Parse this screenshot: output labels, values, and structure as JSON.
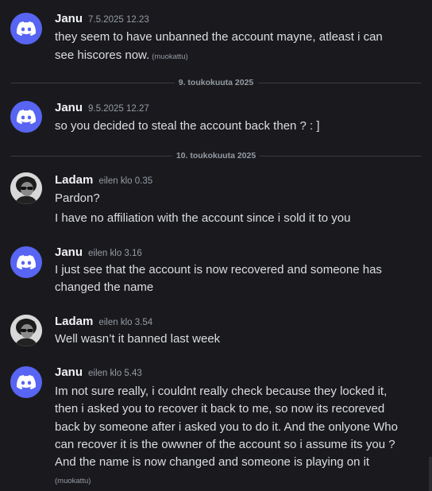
{
  "colors": {
    "background": "#1a1a1e",
    "discord_blurple": "#5865f2",
    "username": "#f2f3f5",
    "message_text": "#dbdee1",
    "muted": "#949ba4"
  },
  "messages": [
    {
      "author": "Janu",
      "avatar_icon": "discord-logo-icon",
      "timestamp": "7.5.2025 12.23",
      "lines": [
        "they seem to have unbanned the account mayne,  atleast i can",
        "see hiscores now."
      ],
      "edited": "(muokattu)"
    },
    {
      "author": "Janu",
      "avatar_icon": "discord-logo-icon",
      "timestamp": "9.5.2025 12.27",
      "lines": [
        "so you decided to steal the account back then ? : ]"
      ]
    },
    {
      "author": "Ladam",
      "avatar_icon": "profile-photo",
      "timestamp": "eilen klo 0.35",
      "lines": [
        "Pardon?",
        "I have no affiliation with the account since i sold it to you"
      ]
    },
    {
      "author": "Janu",
      "avatar_icon": "discord-logo-icon",
      "timestamp": "eilen klo 3.16",
      "lines": [
        "I just see that the account is now recovered and someone has",
        "changed the name"
      ]
    },
    {
      "author": "Ladam",
      "avatar_icon": "profile-photo",
      "timestamp": "eilen klo 3.54",
      "lines": [
        "Well wasn’t it banned last week"
      ]
    },
    {
      "author": "Janu",
      "avatar_icon": "discord-logo-icon",
      "timestamp": "eilen klo 5.43",
      "lines": [
        "Im not sure really, i couldnt really check because they locked it,",
        "then i asked you to recover it back to me, so now its recoreved",
        "back by someone after i asked you to do it. And the onlyone Who",
        "can recover it is the owwner of the account so i assume its you ?",
        "And the name is now changed and someone is playing on it"
      ],
      "edited": "(muokattu)"
    }
  ],
  "dividers": [
    "9. toukokuuta 2025",
    "10. toukokuuta 2025"
  ]
}
